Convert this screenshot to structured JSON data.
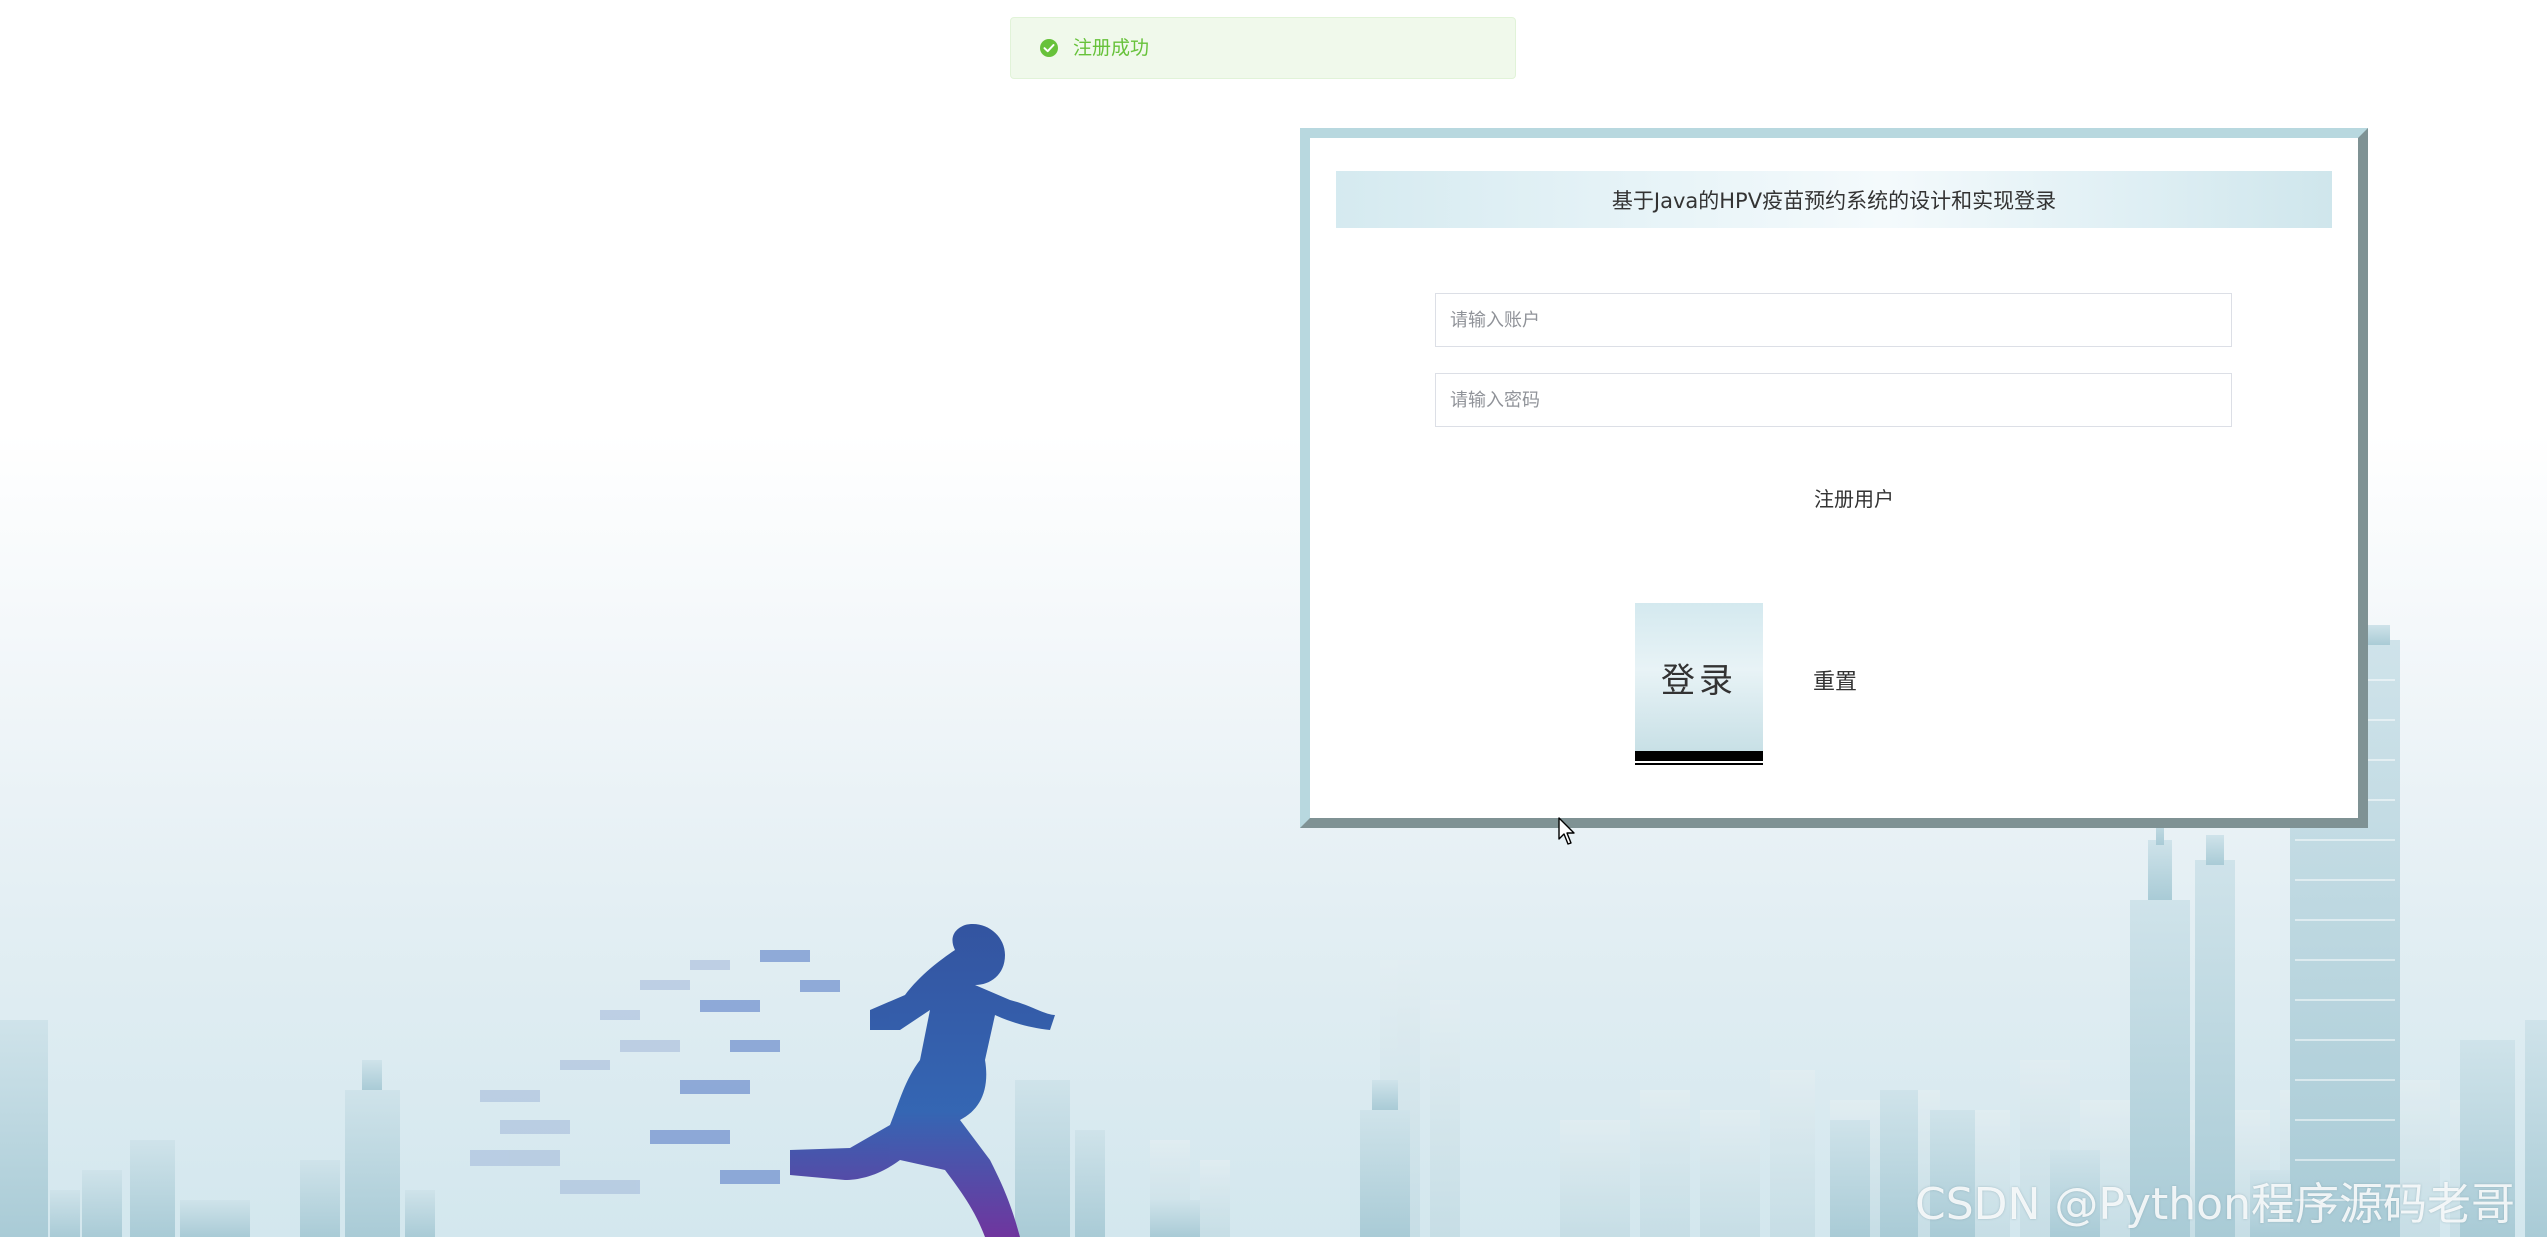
{
  "toast": {
    "icon": "check-circle-icon",
    "message": "注册成功",
    "color": "#67c23a"
  },
  "login": {
    "title": "基于Java的HPV疫苗预约系统的设计和实现登录",
    "account_placeholder": "请输入账户",
    "password_placeholder": "请输入密码",
    "register_label": "注册用户",
    "login_label": "登录",
    "reset_label": "重置"
  },
  "watermark": {
    "text": "CSDN @Python程序源码老哥"
  }
}
